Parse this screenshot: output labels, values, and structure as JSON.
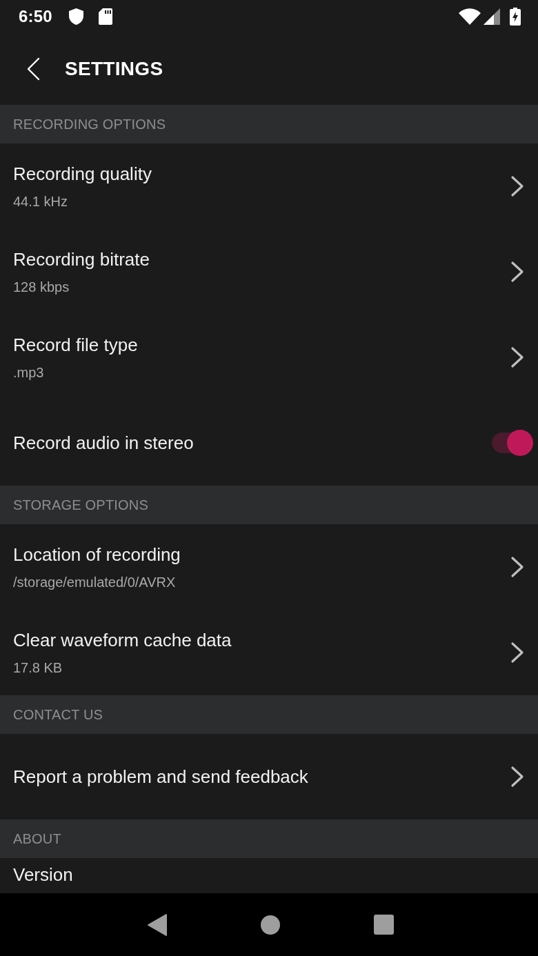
{
  "status_bar": {
    "time": "6:50"
  },
  "app_bar": {
    "title": "SETTINGS"
  },
  "sections": [
    {
      "title": "RECORDING OPTIONS",
      "items": [
        {
          "kind": "link",
          "title": "Recording quality",
          "value": "44.1 kHz"
        },
        {
          "kind": "link",
          "title": "Recording bitrate",
          "value": "128 kbps"
        },
        {
          "kind": "link",
          "title": "Record file type",
          "value": ".mp3"
        },
        {
          "kind": "switch",
          "title": "Record audio in stereo",
          "on": true
        }
      ]
    },
    {
      "title": "STORAGE OPTIONS",
      "items": [
        {
          "kind": "link",
          "title": "Location of recording",
          "value": "/storage/emulated/0/AVRX"
        },
        {
          "kind": "link",
          "title": "Clear waveform cache data",
          "value": "17.8 KB"
        }
      ]
    },
    {
      "title": "CONTACT US",
      "items": [
        {
          "kind": "link",
          "title": "Report a problem and send feedback"
        }
      ]
    },
    {
      "title": "ABOUT",
      "items": [
        {
          "kind": "info",
          "title": "Version"
        }
      ]
    }
  ]
}
